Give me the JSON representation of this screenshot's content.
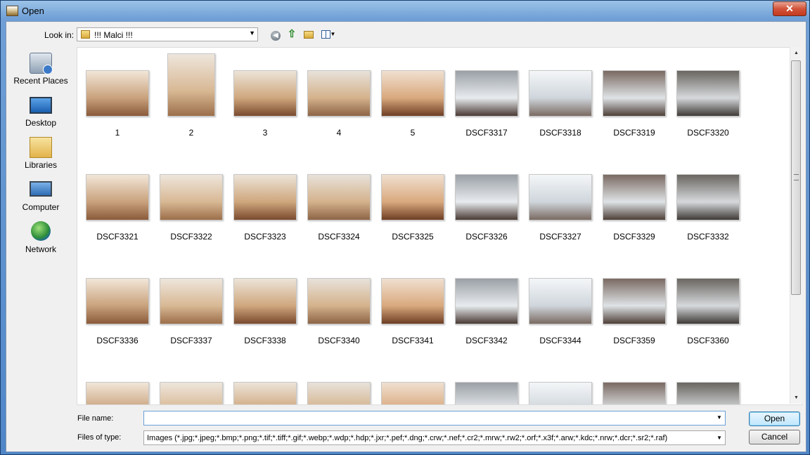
{
  "window": {
    "title": "Open",
    "close_glyph": "✕"
  },
  "toolbar": {
    "look_in_label": "Look in:",
    "look_in_value": "!!! Malci !!!",
    "icons": [
      "back-icon",
      "up-folder-icon",
      "new-folder-icon",
      "view-menu-icon"
    ]
  },
  "places": [
    {
      "label": "Recent Places",
      "icon": "recent-places-icon"
    },
    {
      "label": "Desktop",
      "icon": "desktop-icon"
    },
    {
      "label": "Libraries",
      "icon": "libraries-icon"
    },
    {
      "label": "Computer",
      "icon": "computer-icon"
    },
    {
      "label": "Network",
      "icon": "network-icon"
    }
  ],
  "files": [
    "1",
    "2",
    "3",
    "4",
    "5",
    "DSCF3317",
    "DSCF3318",
    "DSCF3319",
    "DSCF3320",
    "DSCF3321",
    "DSCF3322",
    "DSCF3323",
    "DSCF3324",
    "DSCF3325",
    "DSCF3326",
    "DSCF3327",
    "DSCF3329",
    "DSCF3332",
    "DSCF3336",
    "DSCF3337",
    "DSCF3338",
    "DSCF3340",
    "DSCF3341",
    "DSCF3342",
    "DSCF3344",
    "DSCF3359",
    "DSCF3360",
    "",
    "",
    "",
    "",
    "",
    "",
    "",
    "",
    ""
  ],
  "bottom": {
    "file_name_label": "File name:",
    "file_name_value": "",
    "file_type_label": "Files of type:",
    "file_type_value": "Images (*.jpg;*.jpeg;*.bmp;*.png;*.tif;*.tiff;*.gif;*.webp;*.wdp;*.hdp;*.jxr;*.pef;*.dng;*.crw;*.nef;*.cr2;*.mrw;*.rw2;*.orf;*.x3f;*.arw;*.kdc;*.nrw;*.dcr;*.sr2;*.raf)",
    "open_label": "Open",
    "cancel_label": "Cancel"
  },
  "colors": {
    "title_gradient": "#4f86c8",
    "dialog_bg": "#f0f0f0",
    "close_red": "#c33a1e"
  }
}
